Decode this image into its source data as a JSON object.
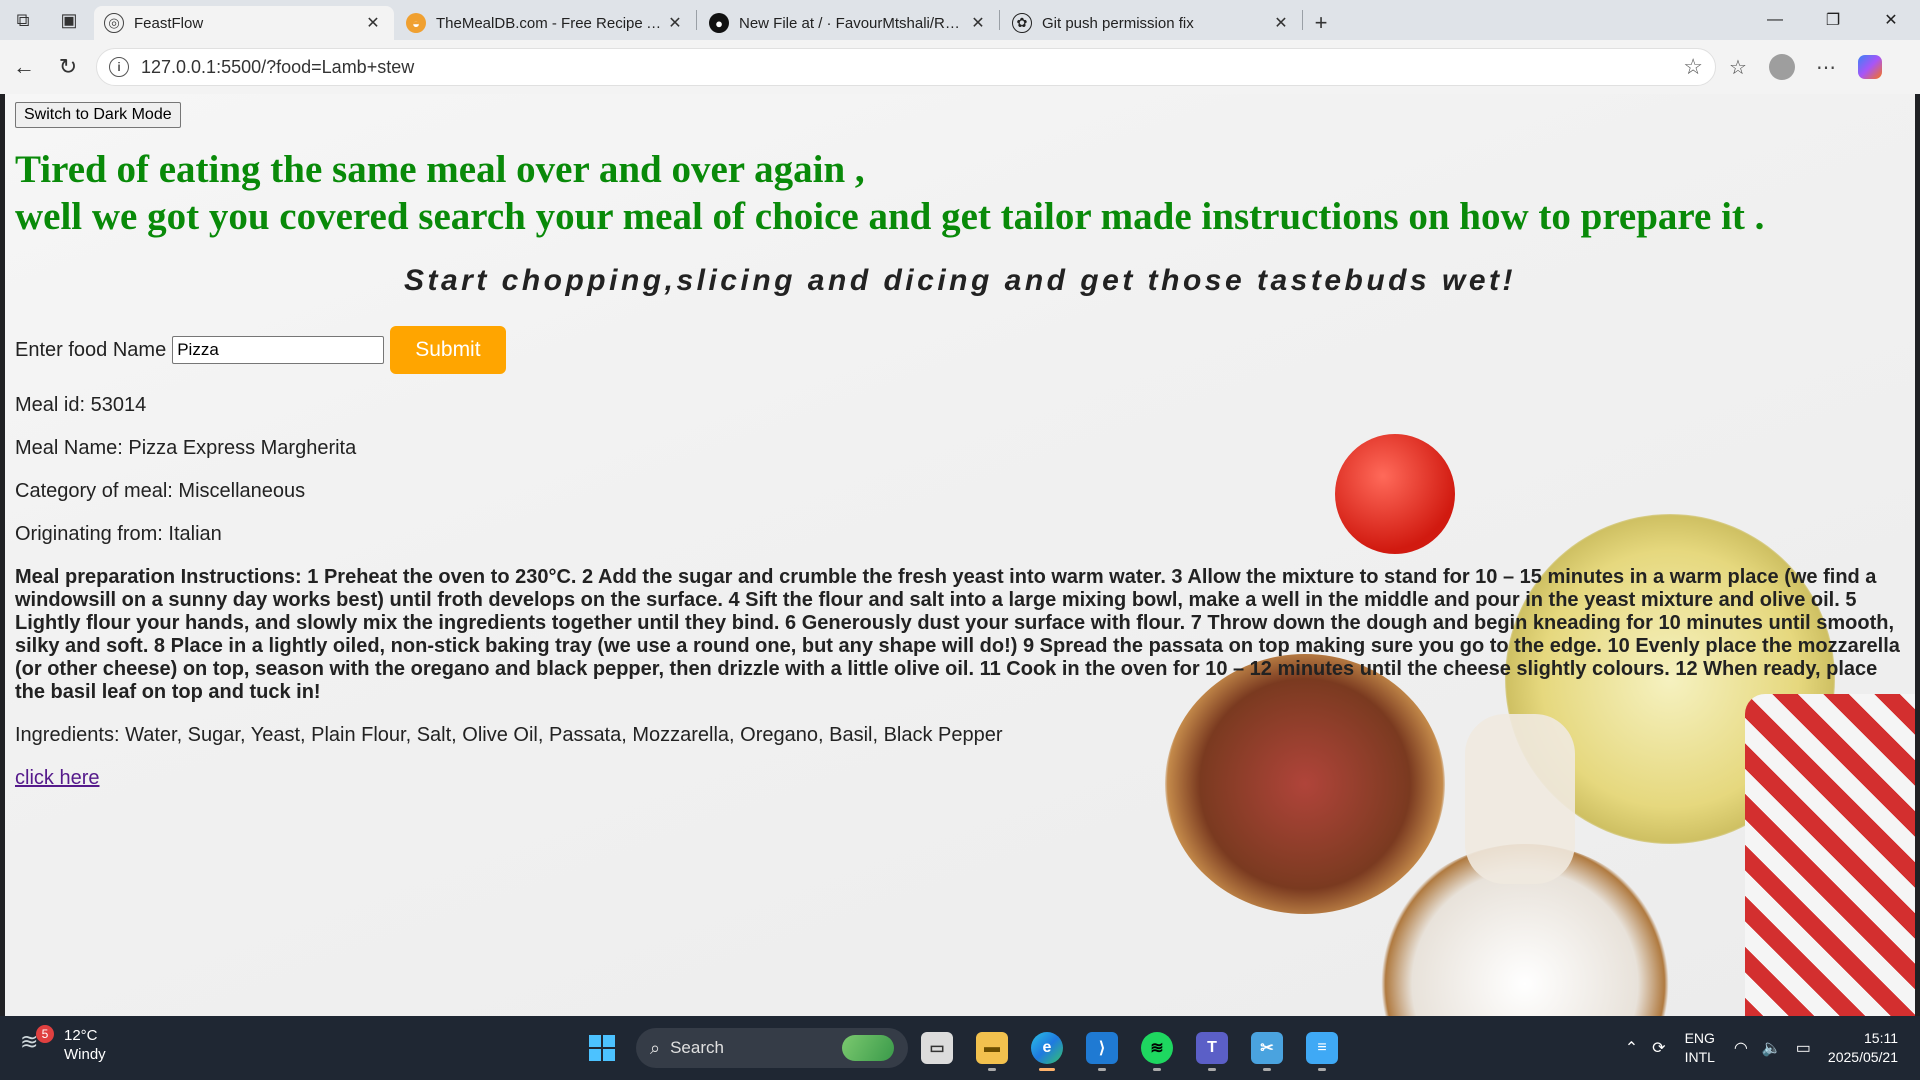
{
  "browser": {
    "tabs": [
      {
        "title": "FeastFlow",
        "favicon": "globe-icon",
        "active": true
      },
      {
        "title": "TheMealDB.com - Free Recipe API",
        "favicon": "meal-icon",
        "active": false
      },
      {
        "title": "New File at / · FavourMtshali/Recipe",
        "favicon": "github-icon",
        "active": false
      },
      {
        "title": "Git push permission fix",
        "favicon": "chatgpt-icon",
        "active": false
      }
    ],
    "url": "127.0.0.1:5500/?food=Lamb+stew"
  },
  "page": {
    "dark_mode_button": "Switch to Dark Mode",
    "headline_line1": "Tired of eating the same meal over and over again ,",
    "headline_line2": "well we got you covered search your meal of choice and get tailor made instructions on how to prepare it .",
    "tagline": "Start chopping,slicing and dicing and get those tastebuds wet!",
    "form": {
      "label": "Enter food Name",
      "input_value": "Pizza",
      "submit_label": "Submit"
    },
    "meal": {
      "id_line": "Meal id: 53014",
      "name_line": "Meal Name: Pizza Express Margherita",
      "category_line": "Category of meal: Miscellaneous",
      "origin_line": "Originating from: Italian",
      "instructions": "Meal preparation Instructions: 1 Preheat the oven to 230°C. 2 Add the sugar and crumble the fresh yeast into warm water. 3 Allow the mixture to stand for 10 – 15 minutes in a warm place (we find a windowsill on a sunny day works best) until froth develops on the surface. 4 Sift the flour and salt into a large mixing bowl, make a well in the middle and pour in the yeast mixture and olive oil. 5 Lightly flour your hands, and slowly mix the ingredients together until they bind. 6 Generously dust your surface with flour. 7 Throw down the dough and begin kneading for 10 minutes until smooth, silky and soft. 8 Place in a lightly oiled, non-stick baking tray (we use a round one, but any shape will do!) 9 Spread the passata on top making sure you go to the edge. 10 Evenly place the mozzarella (or other cheese) on top, season with the oregano and black pepper, then drizzle with a little olive oil. 11 Cook in the oven for 10 – 12 minutes until the cheese slightly colours. 12 When ready, place the basil leaf on top and tuck in!",
      "ingredients_line": "Ingredients: Water, Sugar, Yeast, Plain Flour, Salt, Olive Oil, Passata, Mozzarella, Oregano, Basil, Black Pepper",
      "link_text": "click here"
    },
    "colors": {
      "headline": "#098a09",
      "submit": "#ffa500"
    }
  },
  "taskbar": {
    "weather_temp": "12°C",
    "weather_desc": "Windy",
    "weather_badge": "5",
    "search_label": "Search",
    "lang_line1": "ENG",
    "lang_line2": "INTL",
    "time": "15:11",
    "date": "2025/05/21"
  }
}
